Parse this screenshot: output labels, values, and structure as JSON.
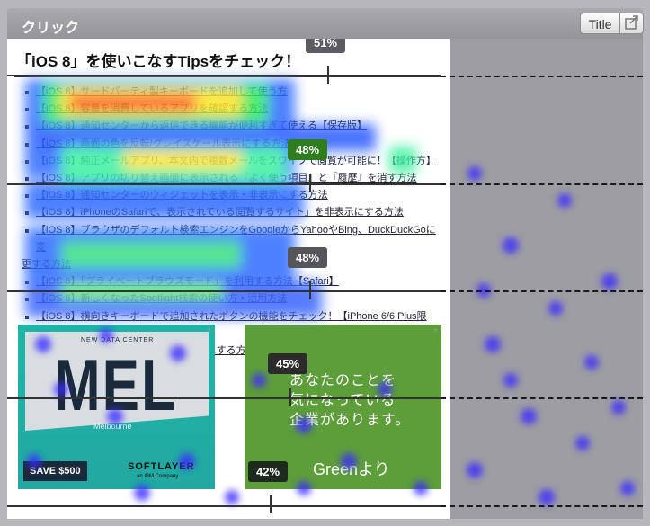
{
  "window": {
    "title": "クリック",
    "title_button": "Title"
  },
  "article": {
    "heading": "「iOS 8」を使いこなすTipsをチェック！",
    "links": [
      "【iOS 8】サードパーティ製キーボードを追加して使う方",
      "【iOS 8】容量を消費しているアプリを確認する方法",
      "【iOS 8】通知センターから返信できる機能が便利すぎて使える【保存版】",
      "【iOS 8】画面の色を反転/グレイスケール表示にする方法",
      "【iOS 8】純正メールアプリ、本文内で複数メールをスワイプで閲覧が可能に！【操作方】",
      "【iOS 8】アプリの切り替え画面に表示される『よく使う項目』と『履歴』を消す方法",
      "【iOS 8】通知センターのウィジェットを表示・非表示にする方法",
      "【iOS 8】iPhoneのSafariで、表示されている閲覧するサイト」を非表示にする方法",
      "【iOS 8】ブラウザのデフォルト検索エンジンをGoogleからYahooやBing、DuckDuckGoに変",
      "更する方法",
      "【iOS 8】「プライベートブラウズモード」を利用する方法【Safari】",
      "【iOS 8】新しくなったSpotlight検索の使い方・活用方法",
      "【iOS 8】横向きキーボードで追加されたボタンの機能をチェック！【iPhone 6/6 Plus限定】",
      "【iOS 8】「QuickType（予測）」を無効にする方法"
    ]
  },
  "ads": {
    "left": {
      "label": "NEW DATA CENTER",
      "title": "MEL",
      "city": "Melbourne",
      "cta": "SAVE $500",
      "brand": "SOFTLAYER",
      "brand_sub": "an IBM Company"
    },
    "right": {
      "text": [
        "あなたのことを",
        "気になっている",
        "企業があります。"
      ],
      "brand": "Greenより"
    }
  },
  "scroll_markers": [
    {
      "value": "51%"
    },
    {
      "value": "48%"
    },
    {
      "value": "48%"
    },
    {
      "value": "45%"
    },
    {
      "value": "42%"
    }
  ],
  "colors": {
    "marker_51": "#5b5b60",
    "marker_48a": "#2e7d1f",
    "marker_48b": "#55555a",
    "marker_45": "#2b2b2b",
    "marker_42": "#1f2a1f"
  }
}
